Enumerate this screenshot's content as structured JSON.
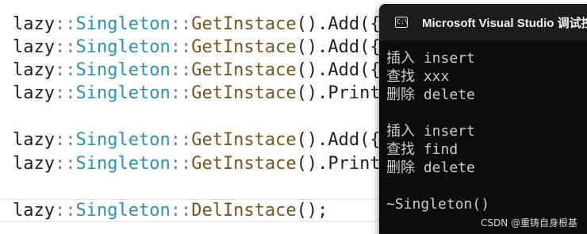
{
  "editor": {
    "lines": [
      {
        "ns": "lazy",
        "sep1": "::",
        "cls": "Singleton",
        "sep2": "::",
        "fn": "GetInstace",
        "rest": "().Add({"
      },
      {
        "ns": "lazy",
        "sep1": "::",
        "cls": "Singleton",
        "sep2": "::",
        "fn": "GetInstace",
        "rest": "().Add({"
      },
      {
        "ns": "lazy",
        "sep1": "::",
        "cls": "Singleton",
        "sep2": "::",
        "fn": "GetInstace",
        "rest": "().Add({"
      },
      {
        "ns": "lazy",
        "sep1": "::",
        "cls": "Singleton",
        "sep2": "::",
        "fn": "GetInstace",
        "rest": "().Print"
      },
      {
        "ns": "lazy",
        "sep1": "::",
        "cls": "Singleton",
        "sep2": "::",
        "fn": "GetInstace",
        "rest": "().Add({"
      },
      {
        "ns": "lazy",
        "sep1": "::",
        "cls": "Singleton",
        "sep2": "::",
        "fn": "GetInstace",
        "rest": "().Print"
      },
      {
        "ns": "lazy",
        "sep1": "::",
        "cls": "Singleton",
        "sep2": "::",
        "fn": "DelInstace",
        "rest": "();"
      }
    ]
  },
  "console": {
    "icon_text": "C:\\",
    "title": "Microsoft Visual Studio 调试控",
    "output": [
      "插入 insert",
      "查找 xxx",
      "删除 delete",
      "插入 insert",
      "查找 find",
      "删除 delete",
      "~Singleton()"
    ]
  },
  "watermark": "CSDN @重铸自身根基",
  "colors": {
    "editor_bg": "#ffffff",
    "type_color": "#2b91af",
    "function_color": "#74531f",
    "scope_color": "#7a7a7a",
    "console_bg": "#0c0c0c",
    "console_text": "#cccccc"
  }
}
